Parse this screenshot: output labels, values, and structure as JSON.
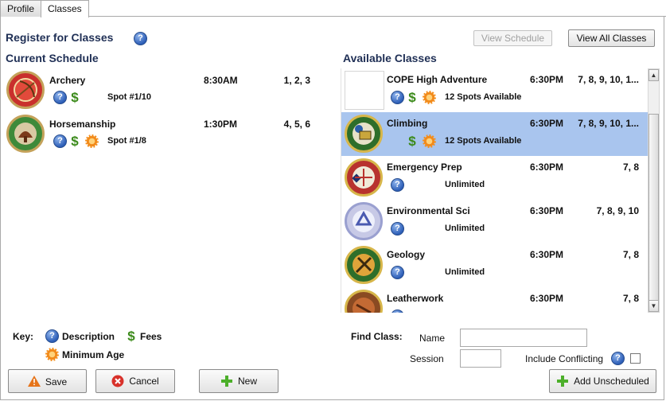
{
  "tabs": [
    {
      "label": "Profile"
    },
    {
      "label": "Classes"
    }
  ],
  "header": {
    "title": "Register for Classes",
    "view_schedule": "View Schedule",
    "view_all": "View All Classes"
  },
  "current": {
    "heading": "Current Schedule",
    "items": [
      {
        "name": "Archery",
        "time": "8:30AM",
        "sessions": "1, 2, 3",
        "spot": "Spot #1/10"
      },
      {
        "name": "Horsemanship",
        "time": "1:30PM",
        "sessions": "4, 5, 6",
        "spot": "Spot #1/8"
      }
    ]
  },
  "available": {
    "heading": "Available Classes",
    "items": [
      {
        "name": "COPE High Adventure",
        "time": "6:30PM",
        "sessions": "7, 8, 9, 10, 1...",
        "status": "12 Spots Available"
      },
      {
        "name": "Climbing",
        "time": "6:30PM",
        "sessions": "7, 8, 9, 10, 1...",
        "status": "12 Spots Available",
        "selected": true
      },
      {
        "name": "Emergency Prep",
        "time": "6:30PM",
        "sessions": "7, 8",
        "status": "Unlimited"
      },
      {
        "name": "Environmental Sci",
        "time": "6:30PM",
        "sessions": "7, 8, 9, 10",
        "status": "Unlimited"
      },
      {
        "name": "Geology",
        "time": "6:30PM",
        "sessions": "7, 8",
        "status": "Unlimited"
      },
      {
        "name": "Leatherwork",
        "time": "6:30PM",
        "sessions": "7, 8",
        "status": ""
      }
    ]
  },
  "key": {
    "label": "Key:",
    "description": "Description",
    "fees": "Fees",
    "min_age": "Minimum Age"
  },
  "find": {
    "label": "Find Class:",
    "name_label": "Name",
    "session_label": "Session",
    "name_value": "",
    "session_value": "",
    "conflicting_label": "Include Conflicting"
  },
  "buttons": {
    "save": "Save",
    "cancel": "Cancel",
    "new": "New",
    "add_unscheduled": "Add Unscheduled"
  },
  "icons": {
    "help": "?",
    "fee": "$"
  },
  "colors": {
    "selected_row": "#a9c5ee",
    "heading": "#1f2f55",
    "help_blue": "#2e5fb8",
    "fee_green": "#3b8a1a",
    "age_orange": "#f28b1c"
  }
}
